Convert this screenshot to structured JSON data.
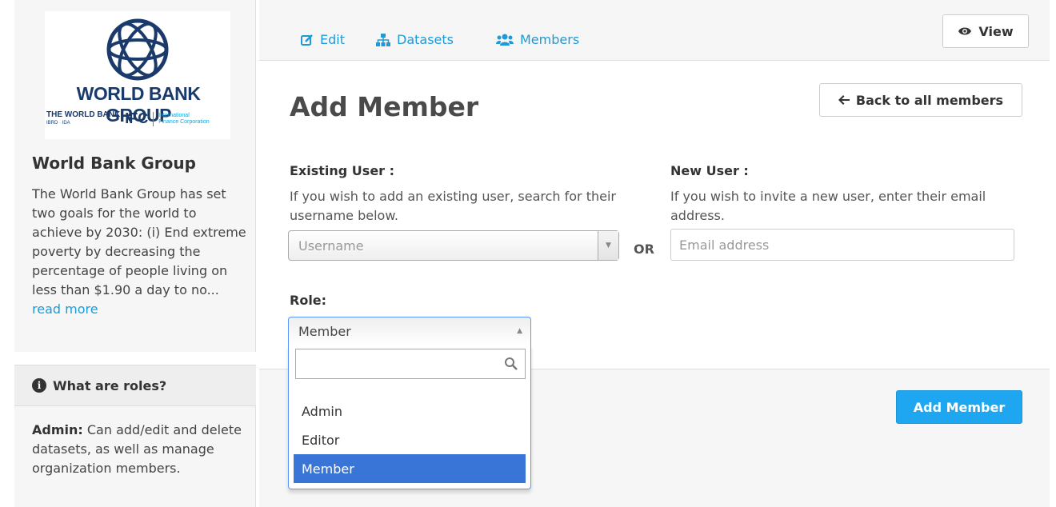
{
  "sidebar": {
    "logo": {
      "title": "WORLD BANK GROUP",
      "sub_wb": "THE WORLD BANK",
      "sub_wb_small": "IBRD · IDA",
      "sub_ifc": "IFC",
      "sub_ifc_desc_1": "International",
      "sub_ifc_desc_2": "Finance Corporation"
    },
    "org_title": "World Bank Group",
    "org_description": "The World Bank Group has set two goals for the world to achieve by 2030: (i) End extreme poverty by decreasing the percentage of people living on less than $1.90 a day to no...",
    "read_more": "read more",
    "roles_heading": "What are roles?",
    "roles_admin_label": "Admin:",
    "roles_admin_text": "Can add/edit and delete datasets, as well as manage organization members."
  },
  "tabs": [
    {
      "label": "Edit",
      "icon": "edit-icon"
    },
    {
      "label": "Datasets",
      "icon": "sitemap-icon"
    },
    {
      "label": "Members",
      "icon": "users-icon"
    }
  ],
  "view_button": "View",
  "page_title": "Add Member",
  "back_button": "Back to all members",
  "existing_user": {
    "label": "Existing User :",
    "help": "If you wish to add an existing user, search for their username below.",
    "placeholder": "Username"
  },
  "or_label": "OR",
  "new_user": {
    "label": "New User :",
    "help": "If you wish to invite a new user, enter their email address.",
    "placeholder": "Email address"
  },
  "role": {
    "label": "Role:",
    "selected": "Member",
    "options": [
      "Admin",
      "Editor",
      "Member"
    ]
  },
  "add_button": "Add Member",
  "colors": {
    "link": "#1f9ad6",
    "primary_button": "#1ea7f0",
    "highlight": "#3875d7",
    "logo_navy": "#1a3a6b"
  }
}
